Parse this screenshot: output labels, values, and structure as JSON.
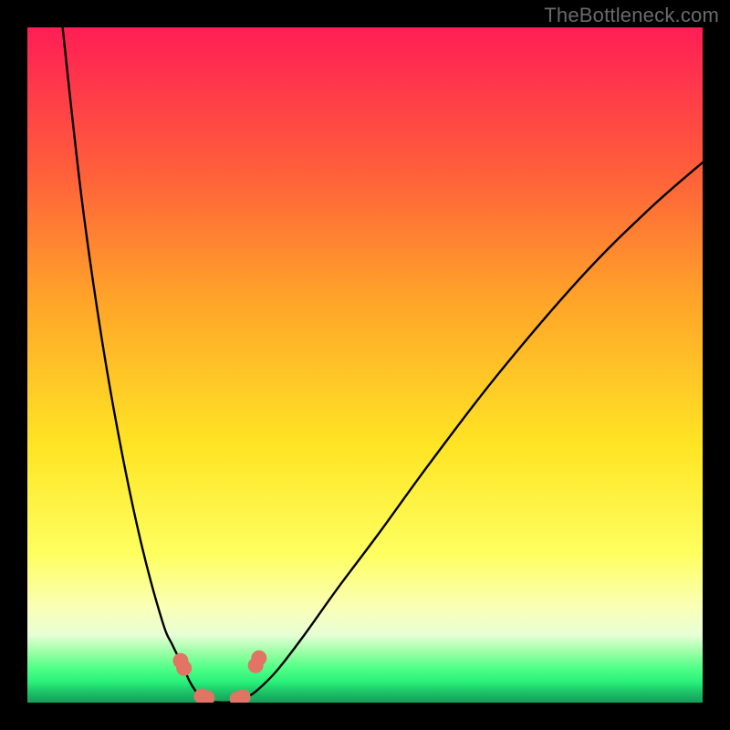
{
  "watermark": "TheBottleneck.com",
  "colors": {
    "frame": "#000000",
    "curve": "#000000",
    "marker_fill": "#e17464",
    "marker_stroke": "#c7503f"
  },
  "chart_data": {
    "type": "line",
    "title": "",
    "xlabel": "",
    "ylabel": "",
    "xlim": [
      0,
      100
    ],
    "ylim": [
      0,
      100
    ],
    "note": "Axes are unlabeled; values are percent-of-plot coordinates estimated from pixels (0,0 = bottom-left).",
    "series": [
      {
        "name": "left-branch",
        "x": [
          5,
          8,
          11,
          14,
          17,
          20,
          21.5,
          23,
          24,
          25,
          26
        ],
        "y": [
          102,
          75,
          54,
          37,
          23,
          12,
          8.5,
          5.5,
          3.2,
          1.6,
          0.5
        ]
      },
      {
        "name": "valley",
        "x": [
          26,
          27,
          28,
          29,
          30,
          31,
          32
        ],
        "y": [
          0.5,
          0.15,
          0.05,
          0.02,
          0.05,
          0.15,
          0.5
        ]
      },
      {
        "name": "right-branch",
        "x": [
          32,
          34,
          37,
          41,
          46,
          52,
          60,
          70,
          82,
          92,
          100
        ],
        "y": [
          0.5,
          1.8,
          4.8,
          10,
          17,
          25,
          36,
          49,
          63,
          73,
          80
        ]
      }
    ],
    "markers": [
      {
        "x": 22.7,
        "y": 6.2
      },
      {
        "x": 23.2,
        "y": 5.1
      },
      {
        "x": 25.8,
        "y": 0.95
      },
      {
        "x": 26.6,
        "y": 0.68
      },
      {
        "x": 31.1,
        "y": 0.54
      },
      {
        "x": 31.9,
        "y": 0.81
      },
      {
        "x": 33.8,
        "y": 5.5
      },
      {
        "x": 34.3,
        "y": 6.6
      }
    ]
  }
}
